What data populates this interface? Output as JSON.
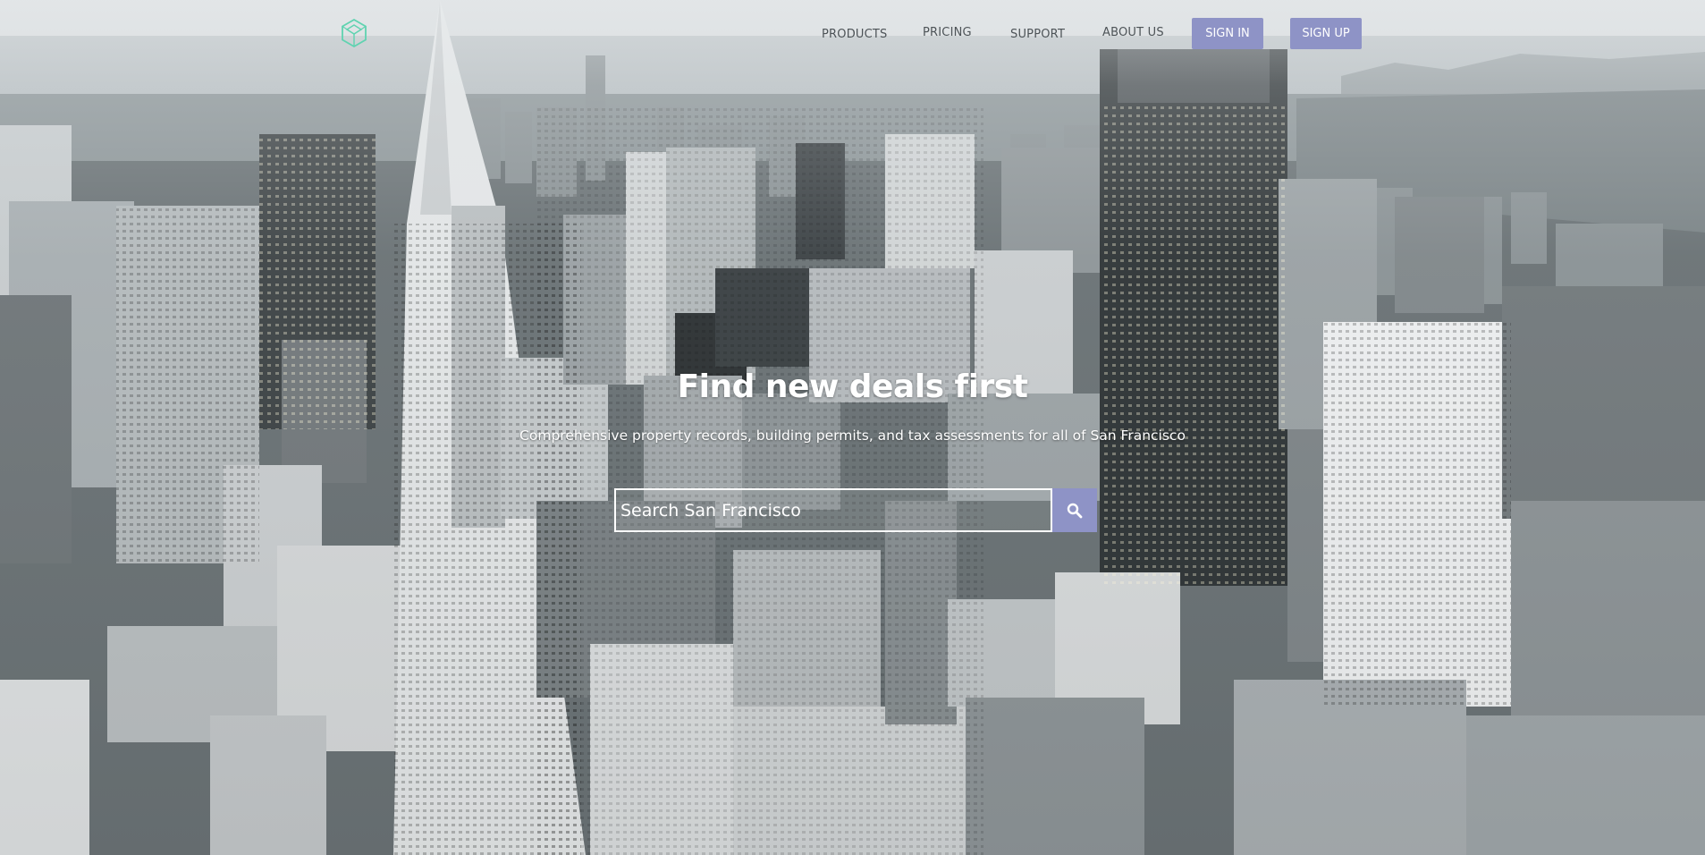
{
  "nav": {
    "logo_icon": "hexagon-cube-logo-icon",
    "links": [
      {
        "label": "PRODUCTS"
      },
      {
        "label": "PRICING"
      },
      {
        "label": "SUPPORT"
      },
      {
        "label": "ABOUT US"
      }
    ],
    "sign_in_label": "SIGN IN",
    "sign_up_label": "SIGN UP"
  },
  "hero": {
    "title": "Find new deals first",
    "subtitle": "Comprehensive property records, building permits, and tax assessments for all of San Francisco",
    "background": "aerial-city-photo"
  },
  "search": {
    "placeholder": "Search San Francisco",
    "button_icon": "search-icon"
  },
  "colors": {
    "accent": "#8e93c6",
    "logo": "#5fd3b0",
    "nav_text": "#4d5357",
    "hero_text": "#ffffff"
  }
}
